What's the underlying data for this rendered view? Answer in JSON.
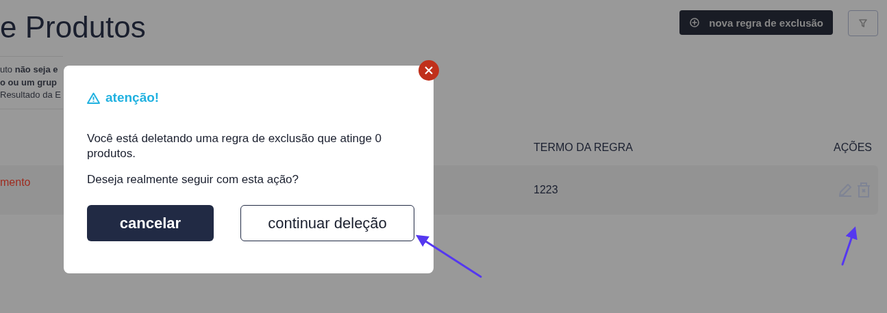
{
  "page": {
    "title": "e Produtos",
    "new_rule_button": "nova regra de exclusão",
    "info_lines": [
      "uto **não seja e**",
      "o ou um grup",
      "Resultado da E"
    ]
  },
  "table": {
    "columns": [
      "TERMO DA REGRA",
      "AÇÕES"
    ],
    "rows": [
      {
        "column_1": "mento",
        "term": "1223"
      }
    ]
  },
  "dialog": {
    "title": "atenção!",
    "message": "Você está deletando uma regra de exclusão que atinge 0 produtos.",
    "question": "Deseja realmente seguir com esta ação?",
    "buttons": [
      {
        "label": "cancelar",
        "kind": "primary"
      },
      {
        "label": "continuar deleção",
        "kind": "outline"
      }
    ]
  }
}
